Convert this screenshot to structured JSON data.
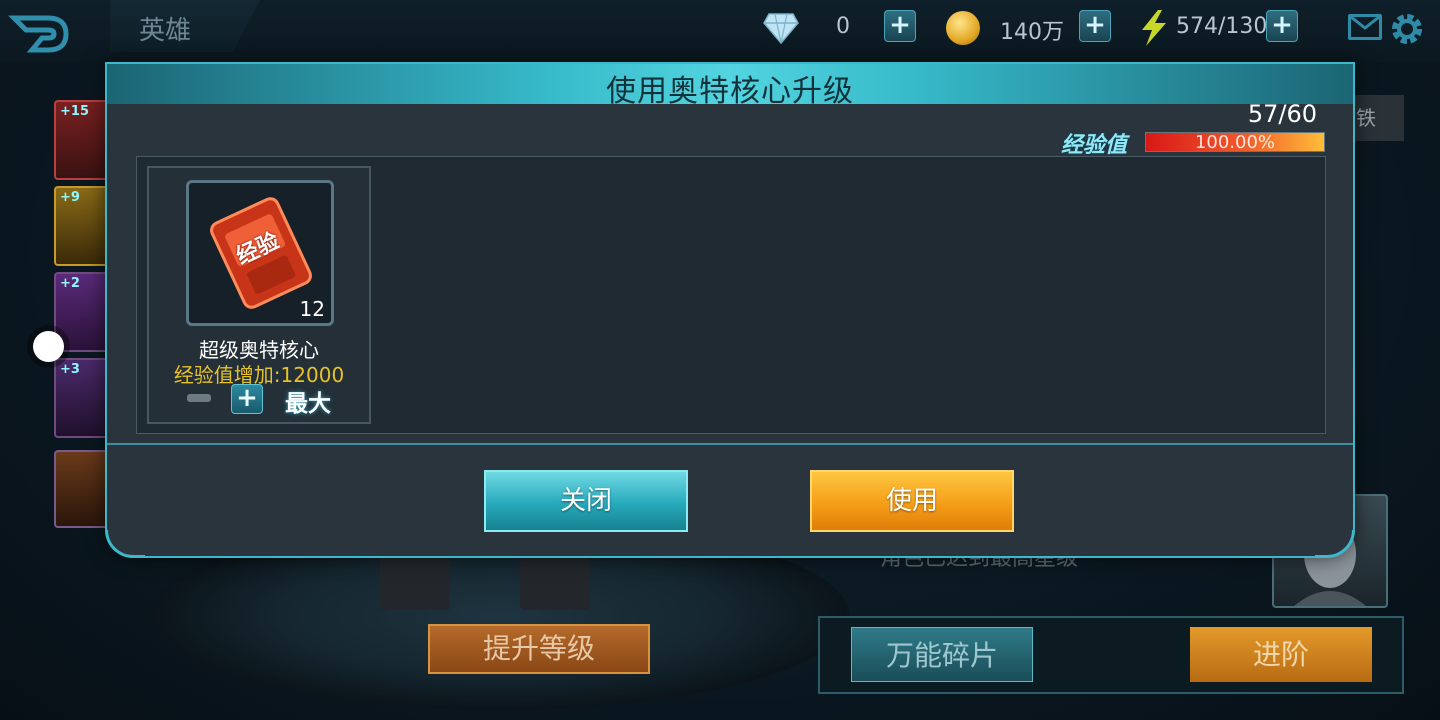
{
  "topbar": {
    "title": "英雄",
    "diamonds": "0",
    "gold": "140万",
    "energy": "574/130",
    "icons": [
      "back-arrow-icon",
      "diamond-icon",
      "gold-coin-icon",
      "lightning-icon",
      "mail-icon",
      "gear-icon"
    ]
  },
  "side_slots": [
    "+15",
    "+9",
    "+2",
    "+3",
    ""
  ],
  "background": {
    "level_up_button": "提升等级",
    "universal_fragment_button": "万能碎片",
    "advance_button": "进阶",
    "right_hint_partial": "铁",
    "obscured_text": "角色已达到最高星级"
  },
  "modal": {
    "title": "使用奥特核心升级",
    "exp_current": "57/60",
    "exp_label": "经验值",
    "exp_percent_text": "100.00%",
    "exp_fraction": 1.0,
    "item": {
      "name": "超级奥特核心",
      "icon_text": "经验",
      "count": "12",
      "effect": "经验值增加:12000",
      "max_label": "最大"
    },
    "close_button": "关闭",
    "use_button": "使用"
  },
  "colors": {
    "accent_teal": "#3db8cb",
    "gold": "#f59e18",
    "exp_fill": "#d81818",
    "effect_text": "#e6c228"
  }
}
